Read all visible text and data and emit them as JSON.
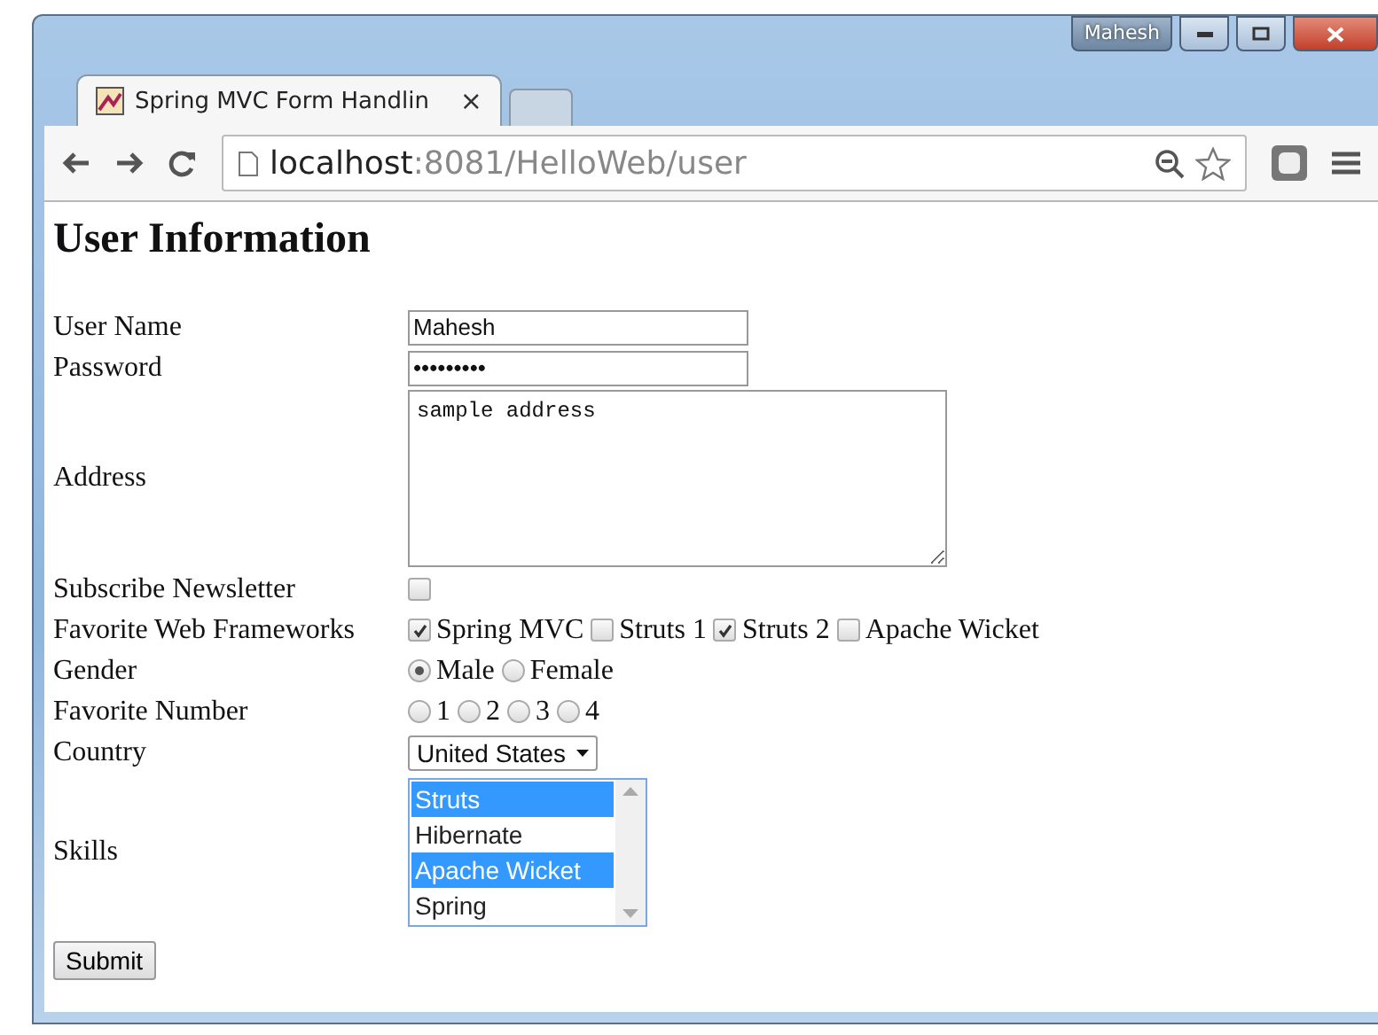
{
  "window": {
    "user": "Mahesh"
  },
  "tab": {
    "title": "Spring MVC Form Handlin",
    "close": "×",
    "selected": true
  },
  "address": {
    "host": "localhost",
    "path": ":8081/HelloWeb/user"
  },
  "heading": "User Information",
  "fields": [
    {
      "kind": "text",
      "label": "User Name",
      "value": "Mahesh"
    },
    {
      "kind": "text",
      "label": "Password",
      "value": "•••••••••"
    },
    {
      "kind": "textarea",
      "label": "Address",
      "value": "sample address"
    },
    {
      "kind": "checkboxes",
      "label": "Subscribe Newsletter",
      "options": [
        {
          "checked": false
        }
      ]
    },
    {
      "kind": "checkboxes",
      "label": "Favorite Web Frameworks",
      "options": [
        {
          "label": "Spring MVC",
          "checked": true
        },
        {
          "label": "Struts 1",
          "checked": false
        },
        {
          "label": "Struts 2",
          "checked": true
        },
        {
          "label": "Apache Wicket",
          "checked": false
        }
      ]
    },
    {
      "kind": "radios",
      "label": "Gender",
      "options": [
        {
          "label": "Male",
          "selected": true
        },
        {
          "label": "Female",
          "selected": false
        }
      ]
    },
    {
      "kind": "radios",
      "label": "Favorite Number",
      "options": [
        {
          "label": "1",
          "selected": false
        },
        {
          "label": "2",
          "selected": false
        },
        {
          "label": "3",
          "selected": false
        },
        {
          "label": "4",
          "selected": false
        }
      ]
    },
    {
      "kind": "select",
      "label": "Country",
      "value": "United States"
    },
    {
      "kind": "listbox",
      "label": "Skills",
      "options": [
        {
          "label": "Struts",
          "selected": true
        },
        {
          "label": "Hibernate",
          "selected": false
        },
        {
          "label": "Apache Wicket",
          "selected": true
        },
        {
          "label": "Spring",
          "selected": false
        }
      ]
    }
  ],
  "submit": "Submit"
}
